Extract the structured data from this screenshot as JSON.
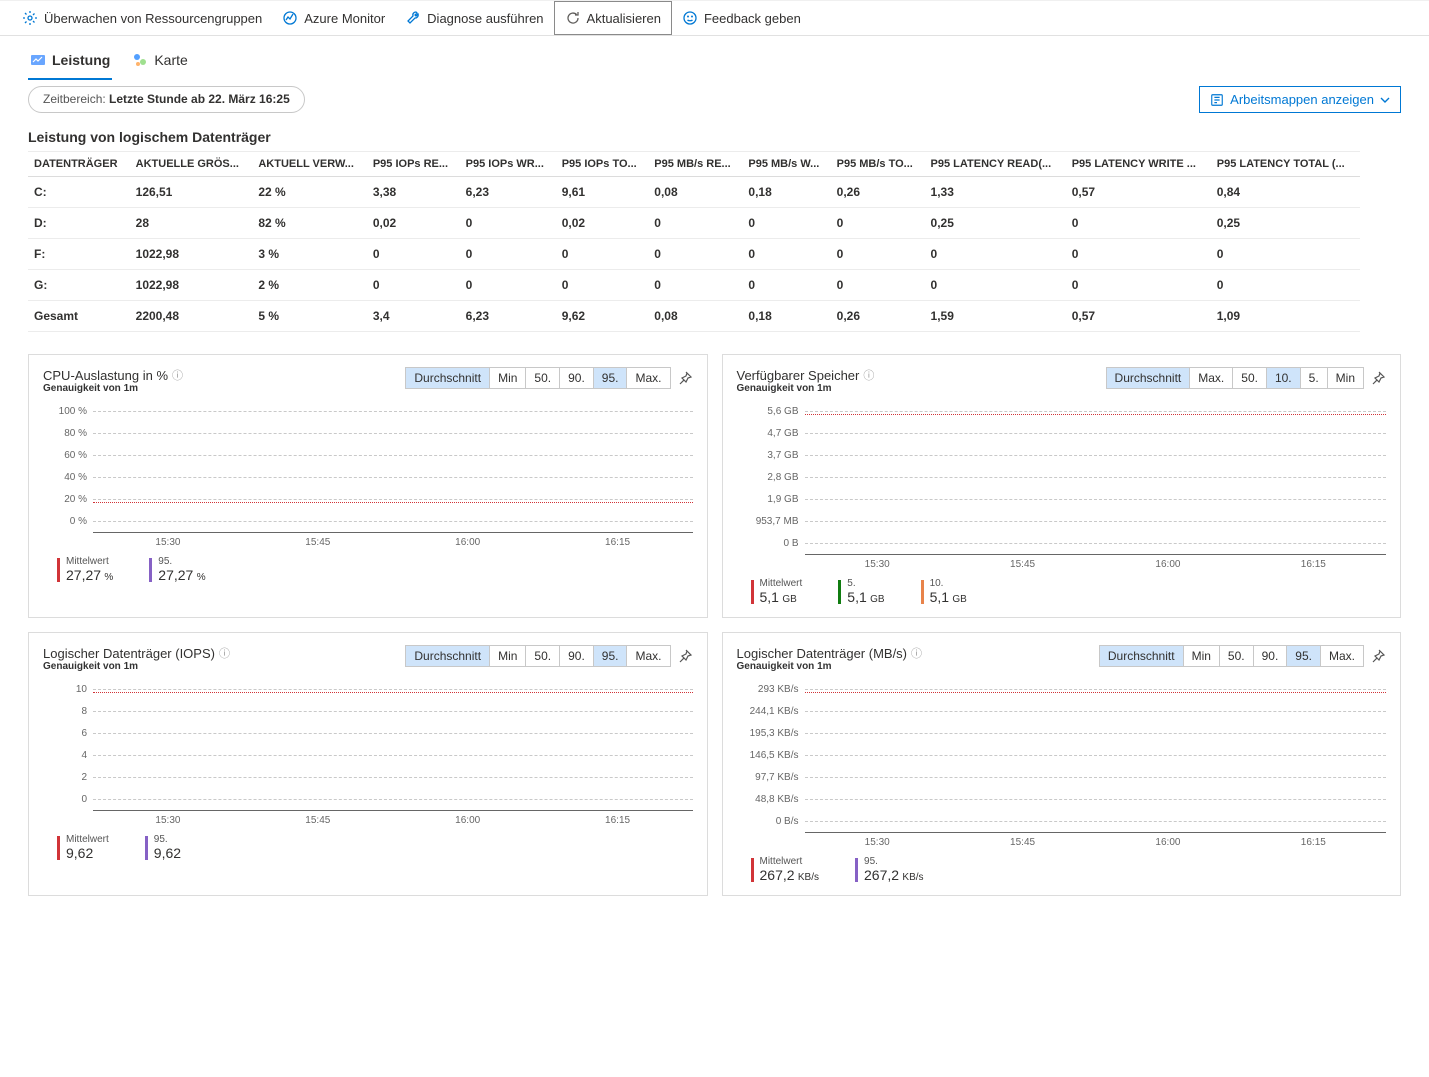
{
  "cmd": {
    "monitorRG": "Überwachen von Ressourcengruppen",
    "azMon": "Azure Monitor",
    "diag": "Diagnose ausführen",
    "refresh": "Aktualisieren",
    "feedback": "Feedback geben"
  },
  "tabs": {
    "perf": "Leistung",
    "map": "Karte"
  },
  "timerange": {
    "label": "Zeitbereich: ",
    "value": "Letzte Stunde ab 22. März 16:25"
  },
  "workbooks": "Arbeitsmappen anzeigen",
  "diskSection": {
    "title": "Leistung von logischem Datenträger",
    "headers": [
      "DATENTRÄGER",
      "AKTUELLE GRÖS...",
      "AKTUELL VERW...",
      "P95 IOPs RE...",
      "P95 IOPs WR...",
      "P95 IOPs TO...",
      "P95 MB/s RE...",
      "P95 MB/s W...",
      "P95 MB/s TO...",
      "P95 LATENCY READ(...",
      "P95 LATENCY WRITE ...",
      "P95 LATENCY TOTAL (..."
    ],
    "rows": [
      [
        "C:",
        "126,51",
        "22 %",
        "3,38",
        "6,23",
        "9,61",
        "0,08",
        "0,18",
        "0,26",
        "1,33",
        "0,57",
        "0,84"
      ],
      [
        "D:",
        "28",
        "82 %",
        "0,02",
        "0",
        "0,02",
        "0",
        "0",
        "0",
        "0,25",
        "0",
        "0,25"
      ],
      [
        "F:",
        "1022,98",
        "3 %",
        "0",
        "0",
        "0",
        "0",
        "0",
        "0",
        "0",
        "0",
        "0"
      ],
      [
        "G:",
        "1022,98",
        "2 %",
        "0",
        "0",
        "0",
        "0",
        "0",
        "0",
        "0",
        "0",
        "0"
      ],
      [
        "Gesamt",
        "2200,48",
        "5 %",
        "3,4",
        "6,23",
        "9,62",
        "0,08",
        "0,18",
        "0,26",
        "1,59",
        "0,57",
        "1,09"
      ]
    ]
  },
  "chart_data": [
    {
      "type": "line",
      "title": "CPU-Auslastung in %",
      "sub": "Genauigkeit von 1m",
      "seg": [
        "Durchschnitt",
        "Min",
        "50.",
        "90.",
        "95.",
        "Max."
      ],
      "selected": [
        0,
        4
      ],
      "yticks": [
        "100 %",
        "80 %",
        "60 %",
        "40 %",
        "20 %",
        "0 %"
      ],
      "xticks": [
        "15:30",
        "15:45",
        "16:00",
        "16:15"
      ],
      "dataLineAfter": 4,
      "series": [
        {
          "name": "Mittelwert",
          "value": "27,27",
          "unit": "%",
          "color": "r"
        },
        {
          "name": "95.",
          "value": "27,27",
          "unit": "%",
          "color": "p"
        }
      ]
    },
    {
      "type": "line",
      "title": "Verfügbarer Speicher",
      "sub": "Genauigkeit von 1m",
      "seg": [
        "Durchschnitt",
        "Max.",
        "50.",
        "10.",
        "5.",
        "Min"
      ],
      "selected": [
        0,
        3
      ],
      "yticks": [
        "5,6 GB",
        "4,7 GB",
        "3,7 GB",
        "2,8 GB",
        "1,9 GB",
        "953,7 MB",
        "0 B"
      ],
      "ywide": true,
      "xticks": [
        "15:30",
        "15:45",
        "16:00",
        "16:15"
      ],
      "dataLineAfter": 0,
      "series": [
        {
          "name": "Mittelwert",
          "value": "5,1",
          "unit": "GB",
          "color": "r"
        },
        {
          "name": "5.",
          "value": "5,1",
          "unit": "GB",
          "color": "g"
        },
        {
          "name": "10.",
          "value": "5,1",
          "unit": "GB",
          "color": "o"
        }
      ]
    },
    {
      "type": "line",
      "title": "Logischer Datenträger (IOPS)",
      "sub": "Genauigkeit von 1m",
      "seg": [
        "Durchschnitt",
        "Min",
        "50.",
        "90.",
        "95.",
        "Max."
      ],
      "selected": [
        0,
        4
      ],
      "yticks": [
        "10",
        "8",
        "6",
        "4",
        "2",
        "0"
      ],
      "xticks": [
        "15:30",
        "15:45",
        "16:00",
        "16:15"
      ],
      "dataLineAfter": 0,
      "series": [
        {
          "name": "Mittelwert",
          "value": "9,62",
          "unit": "",
          "color": "r"
        },
        {
          "name": "95.",
          "value": "9,62",
          "unit": "",
          "color": "p"
        }
      ]
    },
    {
      "type": "line",
      "title": "Logischer Datenträger (MB/s)",
      "sub": "Genauigkeit von 1m",
      "seg": [
        "Durchschnitt",
        "Min",
        "50.",
        "90.",
        "95.",
        "Max."
      ],
      "selected": [
        0,
        4
      ],
      "yticks": [
        "293 KB/s",
        "244,1 KB/s",
        "195,3 KB/s",
        "146,5 KB/s",
        "97,7 KB/s",
        "48,8 KB/s",
        "0 B/s"
      ],
      "ywide": true,
      "xticks": [
        "15:30",
        "15:45",
        "16:00",
        "16:15"
      ],
      "dataLineAfter": 0,
      "series": [
        {
          "name": "Mittelwert",
          "value": "267,2",
          "unit": "KB/s",
          "color": "r"
        },
        {
          "name": "95.",
          "value": "267,2",
          "unit": "KB/s",
          "color": "p"
        }
      ]
    }
  ]
}
